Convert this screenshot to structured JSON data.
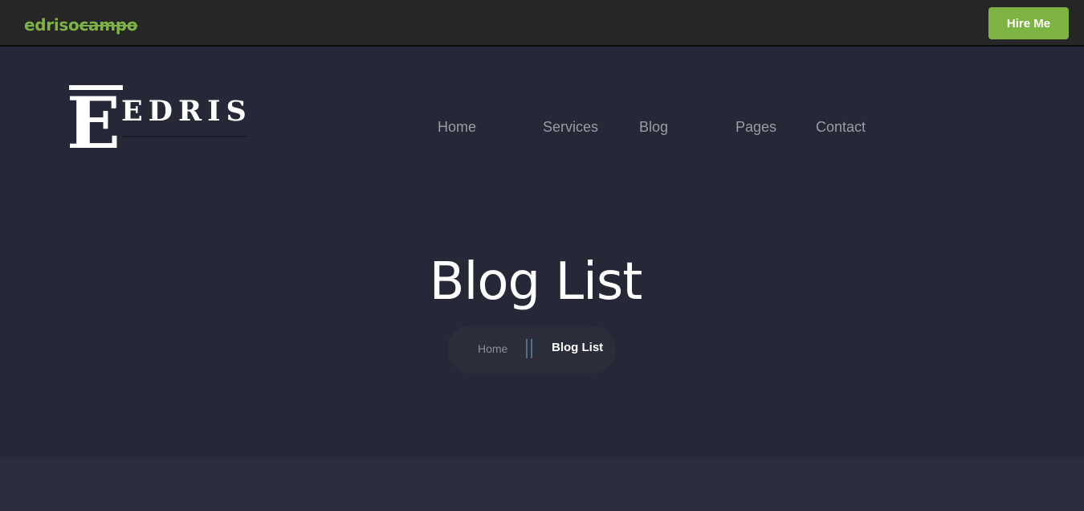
{
  "header": {
    "brand_part1": "edriso",
    "brand_part2": "campo",
    "hire_button_label": "Hire Me"
  },
  "logo": {
    "letter": "E",
    "text": "EDRIS"
  },
  "nav": {
    "items": [
      {
        "label": "Home"
      },
      {
        "label": "Services"
      },
      {
        "label": "Blog"
      },
      {
        "label": "Pages"
      },
      {
        "label": "Contact"
      }
    ]
  },
  "hero": {
    "title": "Blog List",
    "breadcrumb": {
      "home_label": "Home",
      "current_label": "Blog List"
    }
  },
  "colors": {
    "accent": "#7cb342",
    "topbar_bg": "#262626",
    "hero_bg": "#262837",
    "nav_text": "#9a9ba3"
  }
}
